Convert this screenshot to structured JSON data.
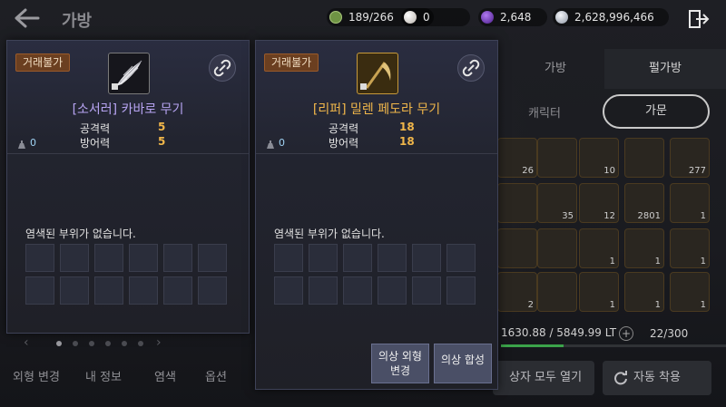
{
  "header": {
    "title": "가방",
    "currencies": [
      {
        "icon": "green-coin-icon",
        "value": "189/266",
        "color": "#7a9f4a"
      },
      {
        "icon": "pearl-icon",
        "value": "0",
        "color": "#d8d4cf"
      },
      {
        "icon": "purple-gem-icon",
        "value": "2,648",
        "color": "#7a3cc6"
      },
      {
        "icon": "silver-coin-icon",
        "value": "2,628,996,466",
        "color": "#c9ced6"
      }
    ]
  },
  "inventory": {
    "tabs": [
      {
        "label": "가방"
      },
      {
        "label": "펄가방"
      }
    ],
    "subtabs": [
      {
        "label": "캐릭터"
      },
      {
        "label": "가문"
      }
    ],
    "slot_counts": [
      "26",
      "10",
      "277",
      "35",
      "12",
      "2801",
      "1",
      "1",
      "2",
      "1",
      "1",
      "1",
      "1",
      "1"
    ],
    "weight": "1630.88 / 5849.99 LT",
    "weight_fraction": 0.28,
    "slots_used": "22/300",
    "open_all_label": "상자 모두 열기",
    "auto_equip_label": "자동 착용"
  },
  "left": {
    "tabs": [
      {
        "label": "외형 변경"
      },
      {
        "label": "내 정보"
      },
      {
        "label": "염색"
      },
      {
        "label": "옵션"
      }
    ]
  },
  "cards": [
    {
      "badge": "거래불가",
      "name": "[소서러] 카바로 무기",
      "name_color": "#b7a4f2",
      "stats": [
        {
          "label": "공격력",
          "value": "5"
        },
        {
          "label": "방어력",
          "value": "5"
        }
      ],
      "weight": "0",
      "dye_text": "염색된 부위가 없습니다."
    },
    {
      "badge": "거래불가",
      "name": "[리퍼] 밀렌 페도라 무기",
      "name_color": "#f0b64a",
      "stats": [
        {
          "label": "공격력",
          "value": "18"
        },
        {
          "label": "방어력",
          "value": "18"
        }
      ],
      "weight": "0",
      "dye_text": "염색된 부위가 없습니다.",
      "buttons": [
        {
          "label_line1": "의상 외형",
          "label_line2": "변경"
        },
        {
          "label_line1": "의상 합성"
        }
      ]
    }
  ]
}
